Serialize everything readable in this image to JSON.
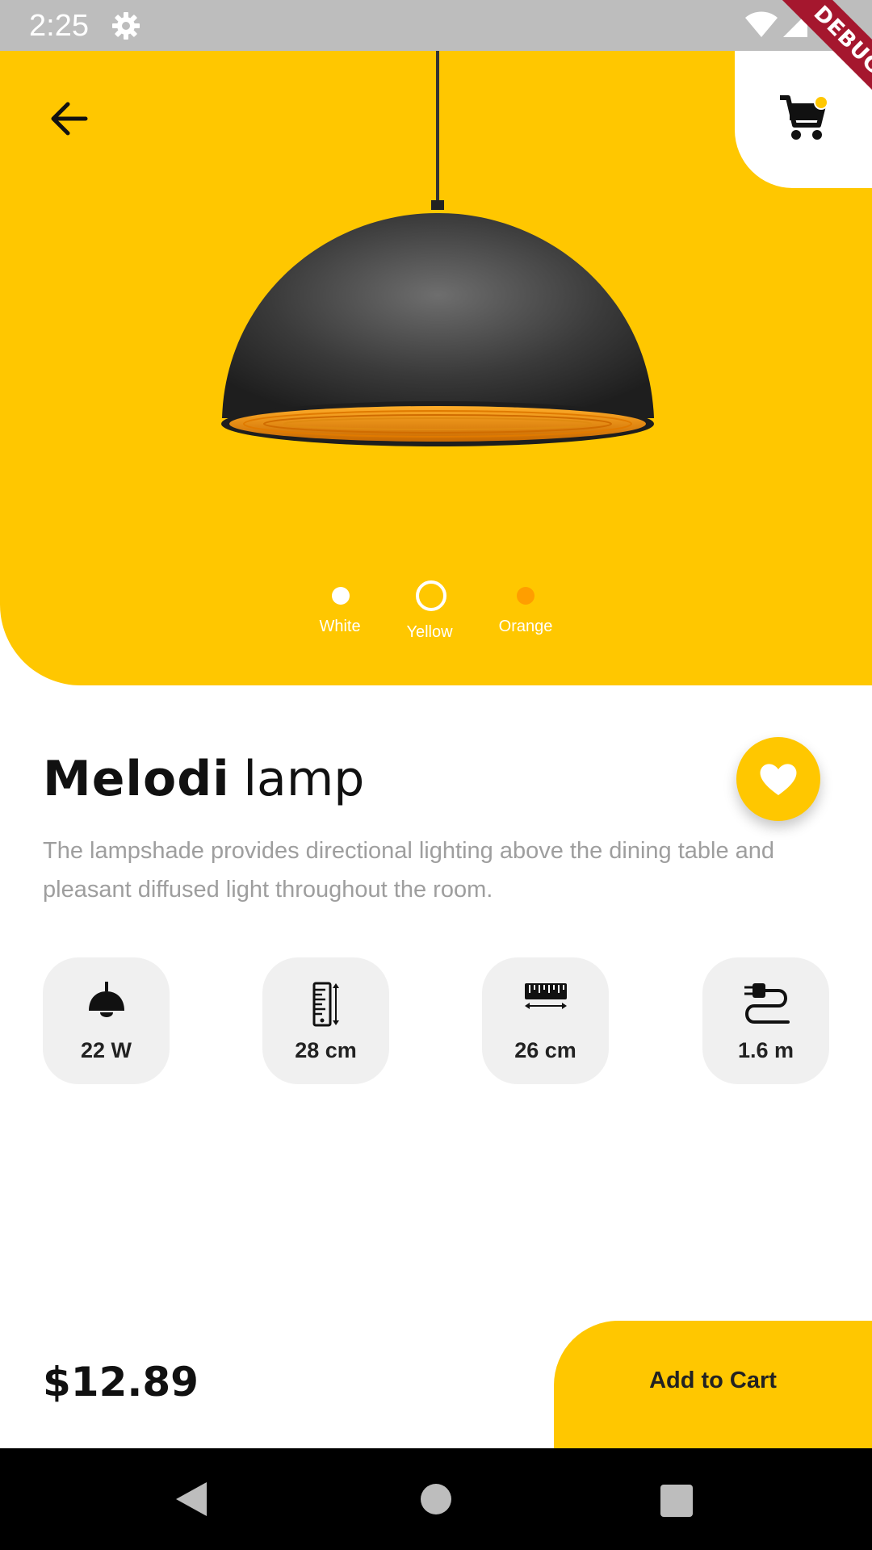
{
  "status_bar": {
    "time": "2:25",
    "debug_label": "DEBUG"
  },
  "hero": {
    "background_color": "#ffc700",
    "colors": [
      {
        "label": "White",
        "swatch": "#ffffff",
        "selected": false
      },
      {
        "label": "Yellow",
        "swatch": "#ffc700",
        "selected": true
      },
      {
        "label": "Orange",
        "swatch": "#ff9e00",
        "selected": false
      }
    ]
  },
  "product": {
    "name_bold": "Melodi",
    "name_light": "lamp",
    "description": "The lampshade provides directional lighting above the dining table and pleasant diffused light throughout the room."
  },
  "specs": [
    {
      "icon": "lamp-icon",
      "value": "22 W"
    },
    {
      "icon": "height-ruler-icon",
      "value": "28 cm"
    },
    {
      "icon": "width-ruler-icon",
      "value": "26 cm"
    },
    {
      "icon": "cable-plug-icon",
      "value": "1.6 m"
    }
  ],
  "footer": {
    "price": "$12.89",
    "add_to_cart_label": "Add to Cart"
  }
}
